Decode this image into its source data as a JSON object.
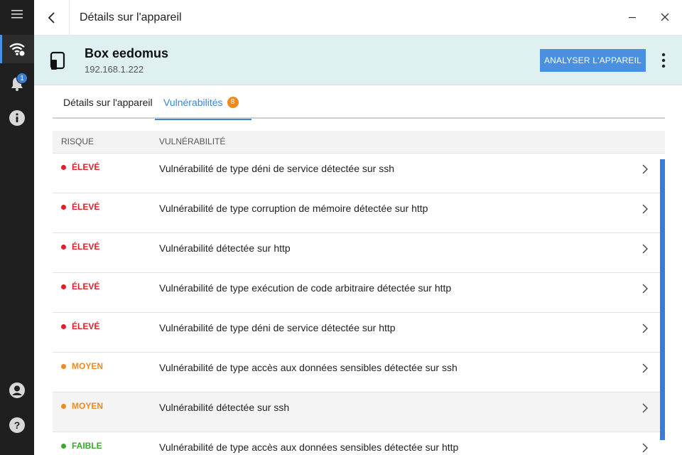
{
  "window": {
    "title": "Détails sur l'appareil"
  },
  "nav": {
    "notification_count": "1"
  },
  "device": {
    "name": "Box eedomus",
    "ip": "192.168.1.222",
    "scan_label": "ANALYSER L'APPAREIL"
  },
  "tabs": {
    "details_label": "Détails sur l'appareil",
    "vulns_label": "Vulnérabilités",
    "vulns_count": "8"
  },
  "table": {
    "col_risk": "RISQUE",
    "col_vuln": "VULNÉRABILITÉ",
    "rows": [
      {
        "risk": "ÉLEVÉ",
        "level": "high",
        "text": "Vulnérabilité de type déni de service détectée sur ssh"
      },
      {
        "risk": "ÉLEVÉ",
        "level": "high",
        "text": "Vulnérabilité de type corruption de mémoire détectée sur http"
      },
      {
        "risk": "ÉLEVÉ",
        "level": "high",
        "text": "Vulnérabilité détectée sur http"
      },
      {
        "risk": "ÉLEVÉ",
        "level": "high",
        "text": "Vulnérabilité de type exécution de code arbitraire détectée sur http"
      },
      {
        "risk": "ÉLEVÉ",
        "level": "high",
        "text": "Vulnérabilité de type déni de service détectée sur http"
      },
      {
        "risk": "MOYEN",
        "level": "medium",
        "text": "Vulnérabilité de type accès aux données sensibles détectée sur ssh"
      },
      {
        "risk": "MOYEN",
        "level": "medium",
        "text": "Vulnérabilité détectée sur ssh"
      },
      {
        "risk": "FAIBLE",
        "level": "low",
        "text": "Vulnérabilité de type accès aux données sensibles détectée sur http"
      }
    ]
  },
  "colors": {
    "high": "#e0202a",
    "medium": "#f08a1c",
    "low": "#3aa830",
    "accent": "#4a8fe0"
  },
  "icons": {
    "menu": "menu-icon",
    "wifi": "wifi-icon",
    "bell": "bell-icon",
    "info": "info-icon",
    "account": "account-icon",
    "help": "help-icon"
  }
}
